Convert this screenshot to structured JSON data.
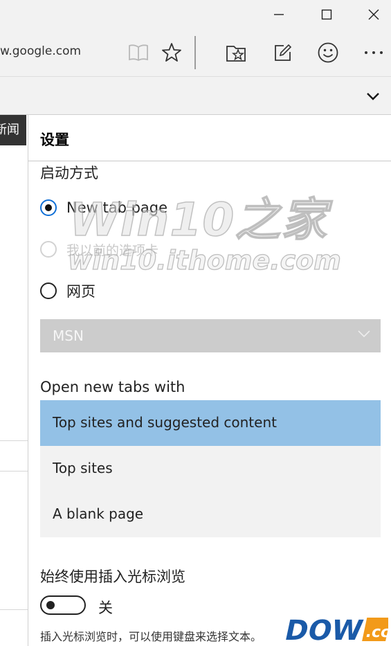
{
  "titlebar": {
    "buttons": [
      "minimize",
      "maximize",
      "close"
    ]
  },
  "address_bar": {
    "url": "w.google.com",
    "icons": [
      "reading-view-icon",
      "favorite-star-icon",
      "hub-icon",
      "web-note-icon",
      "feedback-smiley-icon",
      "more-icon"
    ]
  },
  "left_page": {
    "news_label": "新闻"
  },
  "settings": {
    "title": "设置",
    "startup": {
      "label": "启动方式",
      "options": [
        {
          "label": "New tab page",
          "checked": true,
          "disabled": false
        },
        {
          "label": "我以前的选项卡",
          "checked": false,
          "disabled": true
        },
        {
          "label": "网页",
          "checked": false,
          "disabled": false
        }
      ],
      "page_select": {
        "value": "MSN",
        "disabled": true
      }
    },
    "new_tabs": {
      "label": "Open new tabs with",
      "options": [
        {
          "label": "Top sites and suggested content",
          "selected": true
        },
        {
          "label": "Top sites",
          "selected": false
        },
        {
          "label": "A blank page",
          "selected": false
        }
      ]
    },
    "caret_browsing": {
      "label": "始终使用插入光标浏览",
      "state": "关",
      "description": "插入光标浏览时，可以使用键盘来选择文本。"
    }
  },
  "watermark": {
    "line1": "Win10之家",
    "line2": "win10.ithome.com"
  },
  "logo": {
    "text": "DOWN",
    "suffix": ".cc"
  },
  "colors": {
    "accent": "#0f6fd6",
    "selection": "#93c1e6",
    "chrome_bg": "#f2f2f2",
    "disabled_bg": "#cccccc"
  }
}
